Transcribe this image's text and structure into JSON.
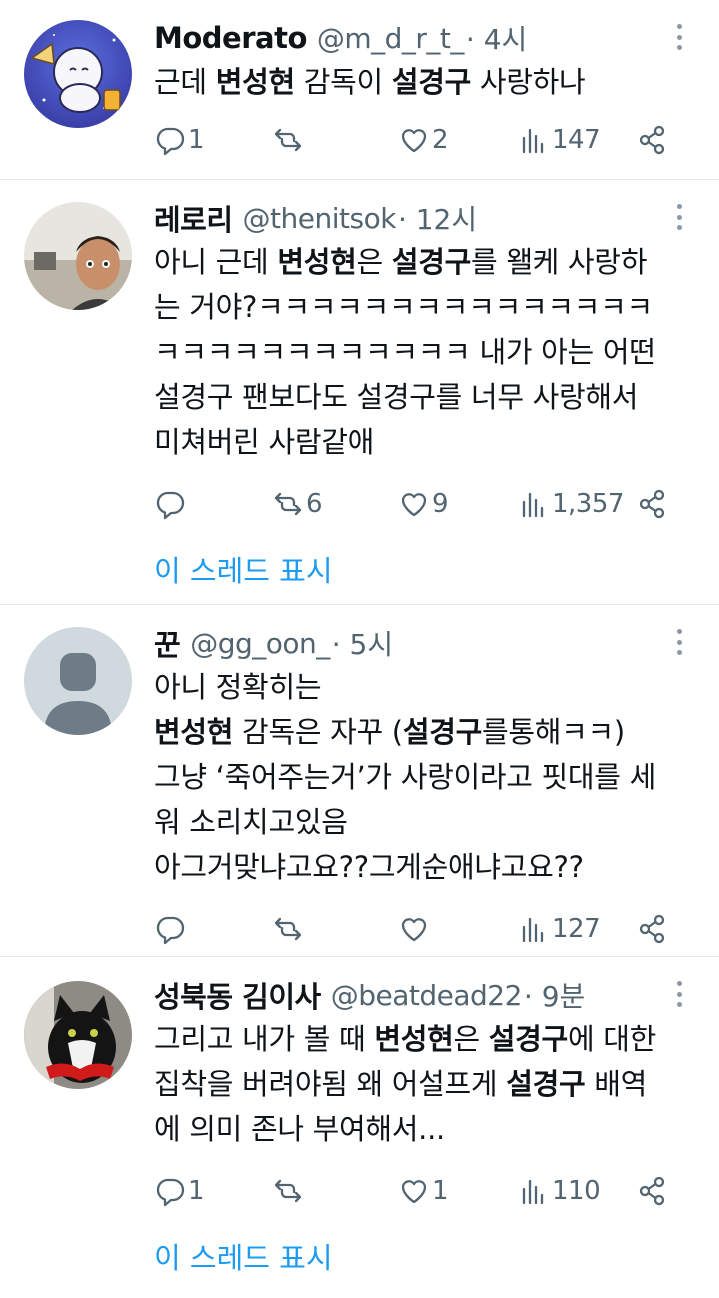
{
  "tweets": [
    {
      "name": "Moderato",
      "handle": "@m_d_r_t_",
      "time": "· 4시",
      "body_html": "근데 <b>변성현</b> 감독이 <b>설경구</b> 사랑하나",
      "replies": "1",
      "retweets": "",
      "likes": "2",
      "views": "147",
      "show_thread": ""
    },
    {
      "name": "레로리",
      "handle": "@thenitsok",
      "time": "· 12시",
      "body_html": "아니 근데 <b>변성현</b>은 <b>설경구</b>를 왤케 사랑하<br>는 거야?ㅋㅋㅋㅋㅋㅋㅋㅋㅋㅋㅋㅋㅋㅋㅋ<br>ㅋㅋㅋㅋㅋㅋㅋㅋㅋㅋㅋㅋ 내가 아는 어떤<br>설경구 팬보다도 설경구를 너무 사랑해서<br>미쳐버린 사람같애",
      "replies": "",
      "retweets": "6",
      "likes": "9",
      "views": "1,357",
      "show_thread": "이 스레드 표시"
    },
    {
      "name": "꾼",
      "handle": "@gg_oon_",
      "time": "· 5시",
      "body_html": "아니 정확히는<br><b>변성현</b> 감독은 자꾸 (<b>설경구</b>를통해ㅋㅋ)<br>그냥 ‘죽어주는거’가 사랑이라고 핏대를 세<br>워 소리치고있음<br>아그거맞냐고요??그게순애냐고요??",
      "replies": "",
      "retweets": "",
      "likes": "",
      "views": "127",
      "show_thread": ""
    },
    {
      "name": "성북동 김이사",
      "handle": "@beatdead22",
      "time": "· 9분",
      "body_html": "그리고 내가 볼 때 <b>변성현</b>은 <b>설경구</b>에 대한<br>집착을 버려야됨 왜 어설프게 <b>설경구</b> 배역<br>에 의미 존나 부여해서...",
      "replies": "1",
      "retweets": "",
      "likes": "1",
      "views": "110",
      "show_thread": "이 스레드 표시"
    }
  ],
  "icons": {
    "reply": "reply-icon",
    "retweet": "retweet-icon",
    "like": "heart-icon",
    "views": "analytics-icon",
    "share": "share-icon",
    "more": "more-icon"
  },
  "colors": {
    "link": "#1d9bf0",
    "secondary": "#536471",
    "text": "#0f1419",
    "divider": "#e6e9eb"
  }
}
